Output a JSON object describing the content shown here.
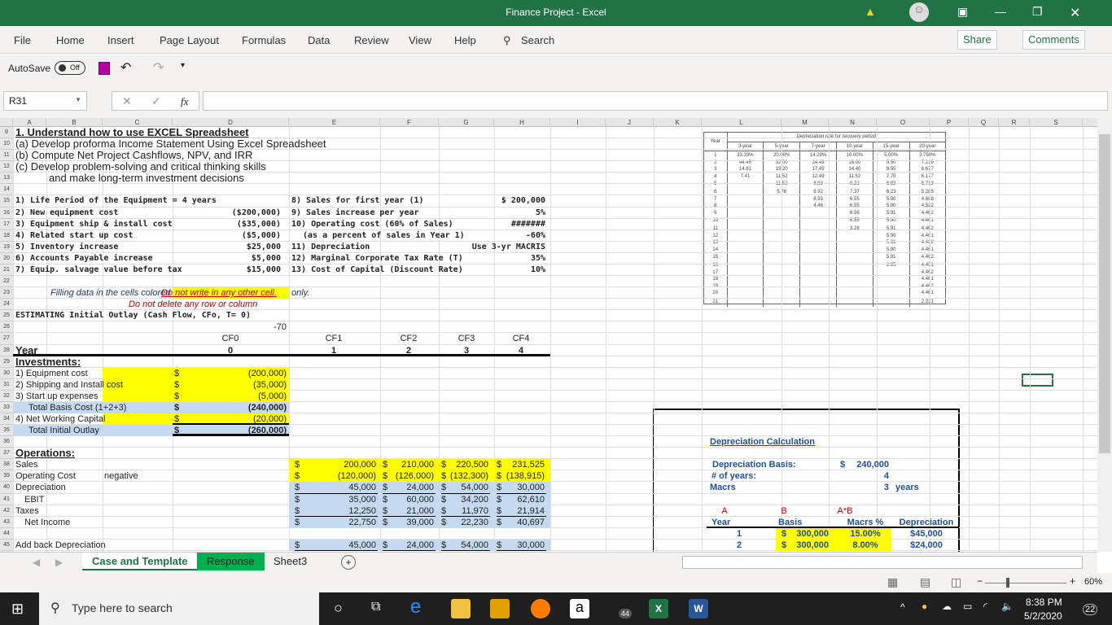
{
  "window": {
    "title": "Finance Project  -  Excel",
    "warning_icon": "warning-icon",
    "avatar_icon": "user-icon"
  },
  "menu": {
    "items": [
      "File",
      "Home",
      "Insert",
      "Page Layout",
      "Formulas",
      "Data",
      "Review",
      "View",
      "Help"
    ],
    "search": "Search",
    "share": "Share",
    "comments": "Comments"
  },
  "qat": {
    "autosave": "AutoSave",
    "toggle": "Off"
  },
  "formula_bar": {
    "name_box": "R31",
    "fx": "fx",
    "formula": ""
  },
  "columns": [
    "A",
    "B",
    "C",
    "D",
    "E",
    "F",
    "G",
    "H",
    "I",
    "J",
    "K",
    "L",
    "M",
    "N",
    "O",
    "P",
    "Q",
    "R",
    "S"
  ],
  "sheet": {
    "heading": {
      "title": "1. Understand how to use EXCEL Spreadsheet",
      "a": "(a) Develop proforma Income Statement Using Excel Spreadsheet",
      "b": "(b) Compute  Net Project Cashflows, NPV, and IRR",
      "c": "(c) Develop problem-solving and  critical thinking skills",
      "d": "and make long-term investment decisions"
    },
    "params_left": [
      {
        "label": "1) Life Period of the Equipment = 4 years",
        "value": ""
      },
      {
        "label": "2) New equipment cost",
        "value": "($200,000)"
      },
      {
        "label": "3) Equipment ship & install cost",
        "value": "($35,000)"
      },
      {
        "label": "4) Related start up cost",
        "value": "($5,000)"
      },
      {
        "label": "5) Inventory increase",
        "value": "$25,000"
      },
      {
        "label": "6) Accounts Payable increase",
        "value": "$5,000"
      },
      {
        "label": "7) Equip. salvage value before tax",
        "value": "$15,000"
      }
    ],
    "params_right": [
      {
        "label": "8) Sales for first year (1)",
        "value": "$ 200,000"
      },
      {
        "label": "9) Sales increase per year",
        "value": "5%"
      },
      {
        "label": "10) Operating cost (60% of Sales)",
        "value": "#######"
      },
      {
        "label": "(as a percent of sales in Year 1)",
        "value": "-60%"
      },
      {
        "label": "11) Depreciation",
        "value": "Use 3-yr MACRIS"
      },
      {
        "label": "12) Marginal Corporate Tax Rate (T)",
        "value": "35%"
      },
      {
        "label": "13) Cost of Capital (Discount Rate)",
        "value": "10%"
      }
    ],
    "note": {
      "fill": "Filling data in the cells colored",
      "only": "only.",
      "no_write": "Do not write in any other cell.",
      "no_delete": "Do not delete any row or column"
    },
    "section_title": "ESTIMATING  Initial Outlay (Cash Flow, CFo, T= 0)",
    "d26": "-70",
    "cf_headers": [
      "CF0",
      "CF1",
      "CF2",
      "CF3",
      "CF4"
    ],
    "year_label": "Year",
    "years": [
      "0",
      "1",
      "2",
      "3",
      "4"
    ],
    "investments": {
      "title": "Investments:",
      "rows": [
        {
          "label": "1) Equipment cost",
          "cur": "$",
          "value": "(200,000)"
        },
        {
          "label": "2) Shipping and Install cost",
          "cur": "$",
          "value": "(35,000)"
        },
        {
          "label": "3) Start up expenses",
          "cur": "$",
          "value": "(5,000)"
        },
        {
          "label": "Total Basis Cost (1+2+3)",
          "cur": "$",
          "value": "(240,000)"
        },
        {
          "label": "4)  Net Working Capital",
          "cur": "$",
          "value": "(20,000)"
        },
        {
          "label": "Total Initial Outlay",
          "cur": "$",
          "value": "(260,000)"
        }
      ]
    },
    "operations": {
      "title": "Operations:",
      "negative_note": "negative",
      "rows": [
        {
          "label": "Sales",
          "values": [
            "200,000",
            "210,000",
            "220,500",
            "231,525"
          ]
        },
        {
          "label": "Operating Cost",
          "values": [
            "(120,000)",
            "(126,000)",
            "(132,300)",
            "(138,915)"
          ]
        },
        {
          "label": "Depreciation",
          "values": [
            "45,000",
            "24,000",
            "54,000",
            "30,000"
          ]
        },
        {
          "label": "EBIT",
          "values": [
            "35,000",
            "60,000",
            "34,200",
            "62,610"
          ]
        },
        {
          "label": "Taxes",
          "values": [
            "12,250",
            "21,000",
            "11,970",
            "21,914"
          ]
        },
        {
          "label": "Net Income",
          "values": [
            "22,750",
            "39,000",
            "22,230",
            "40,697"
          ]
        },
        {
          "label": "Add back  Depreciation",
          "values": [
            "45,000",
            "24,000",
            "54,000",
            "30,000"
          ]
        }
      ],
      "cur": "$"
    },
    "macrs_table": {
      "title": "Depreciation rate for recovery period",
      "year": "Year",
      "periods": [
        "3-year",
        "5-year",
        "7-year",
        "10-year",
        "15-year",
        "20-year"
      ],
      "groups": [
        {
          "years": "1\n2\n3\n4\n5",
          "cols": [
            "33.33%\n44.45\n14.81\n7.41",
            "20.00%\n32.00\n19.20\n11.52\n11.52",
            "14.29%\n24.49\n17.49\n12.49\n8.93",
            "10.00%\n18.00\n14.40\n11.52\n9.22",
            "5.00%\n9.50\n8.55\n7.70\n6.93",
            "3.750%\n7.219\n6.677\n6.177\n5.713"
          ]
        },
        {
          "years": "6\n7\n8\n9\n10",
          "cols": [
            "",
            "5.76",
            "8.92\n8.93\n4.46",
            "7.37\n6.55\n6.55\n6.56\n6.55",
            "6.23\n5.90\n5.90\n5.91\n5.90",
            "5.285\n4.888\n4.522\n4.462\n4.461"
          ]
        },
        {
          "years": "11\n12\n13\n14\n15",
          "cols": [
            "",
            "",
            "",
            "3.28",
            "5.91\n5.90\n5.91\n5.90\n5.91",
            "4.462\n4.461\n4.462\n4.461\n4.462"
          ]
        },
        {
          "years": "16\n17\n18\n19\n20",
          "cols": [
            "",
            "",
            "",
            "",
            "2.95",
            "4.461\n4.462\n4.461\n4.462\n4.461"
          ]
        },
        {
          "years": "21",
          "cols": [
            "",
            "",
            "",
            "",
            "",
            "2.231"
          ]
        }
      ]
    },
    "dep_calc": {
      "title": "Depreciation Calculation",
      "basis_label": "Depreciation Basis:",
      "basis_cur": "$",
      "basis": "240,000",
      "years_label": "# of years:",
      "years": "4",
      "macrs_label": "Macrs",
      "macrs": "3",
      "macrs_unit": "years",
      "col_tags": [
        "A",
        "B",
        "A*B"
      ],
      "headers": [
        "Year",
        "Basis",
        "Macrs %",
        "Depreciation"
      ],
      "rows": [
        {
          "year": "1",
          "cur": "$",
          "basis": "300,000",
          "pct": "15.00%",
          "dep": "$45,000"
        },
        {
          "year": "2",
          "cur": "$",
          "basis": "300,000",
          "pct": "8.00%",
          "dep": "$24,000"
        }
      ]
    }
  },
  "tabs": [
    "Case and Template",
    "Response",
    "Sheet3"
  ],
  "active_tab": "Case and Template",
  "status": {
    "zoom": "60%"
  },
  "taskbar": {
    "search": "Type here to search",
    "time": "8:38 PM",
    "date": "5/2/2020",
    "notifications": "22",
    "mail_badge": "44"
  },
  "colors": {
    "excel_green": "#217346",
    "input_yellow": "#ffff00",
    "calc_blue": "#c5d9f1",
    "warning_red": "#c00000",
    "response_tab": "#00b050"
  }
}
